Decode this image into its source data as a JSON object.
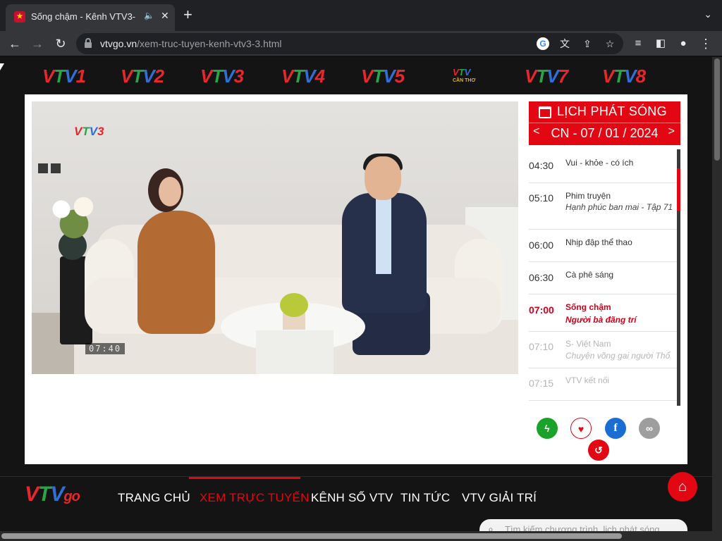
{
  "browser": {
    "tab_title": "Sống chậm - Kênh VTV3-",
    "url_host": "vtvgo.vn",
    "url_path": "/xem-truc-tuyen-kenh-vtv3-3.html"
  },
  "channels": [
    {
      "name": "VTV1",
      "num": "1"
    },
    {
      "name": "VTV2",
      "num": "2"
    },
    {
      "name": "VTV3",
      "num": "3"
    },
    {
      "name": "VTV4",
      "num": "4"
    },
    {
      "name": "VTV5",
      "num": "5"
    },
    {
      "name": "VTV",
      "sub": "CẦN THƠ"
    },
    {
      "name": "VTV7",
      "num": "7"
    },
    {
      "name": "VTV8",
      "num": "8"
    }
  ],
  "player": {
    "logo_num": "3",
    "timecode": "07:40"
  },
  "schedule": {
    "title": "LỊCH PHÁT SÓNG",
    "date": "CN - 07 / 01 / 2024",
    "prev": "<",
    "next": ">",
    "items": [
      {
        "time": "04:30",
        "name": "Vui - khỏe - có ích",
        "episode": ""
      },
      {
        "time": "05:10",
        "name": "Phim truyện",
        "episode": "Hạnh phúc ban mai - Tập 71"
      },
      {
        "time": "06:00",
        "name": "Nhịp đập thể thao",
        "episode": ""
      },
      {
        "time": "06:30",
        "name": "Cà phê sáng",
        "episode": ""
      },
      {
        "time": "07:00",
        "name": "Sống chậm",
        "episode": "Người bà đãng trí"
      },
      {
        "time": "07:10",
        "name": "S- Việt Nam",
        "episode": "Chuyện võng gai người Thổ"
      },
      {
        "time": "07:15",
        "name": "VTV kết nối",
        "episode": ""
      }
    ]
  },
  "nav": {
    "brand_go": "go",
    "items": [
      "TRANG CHỦ",
      "XEM TRỰC TUYẾN",
      "KÊNH SỐ VTV",
      "TIN TỨC",
      "VTV GIẢI TRÍ"
    ]
  },
  "search": {
    "placeholder": "Tìm kiếm chương trình, lịch phát sóng"
  },
  "colors": {
    "accent": "#e30613",
    "vtv_red": "#e8262c",
    "vtv_green": "#2aa34a",
    "vtv_blue": "#2f6fd6"
  }
}
